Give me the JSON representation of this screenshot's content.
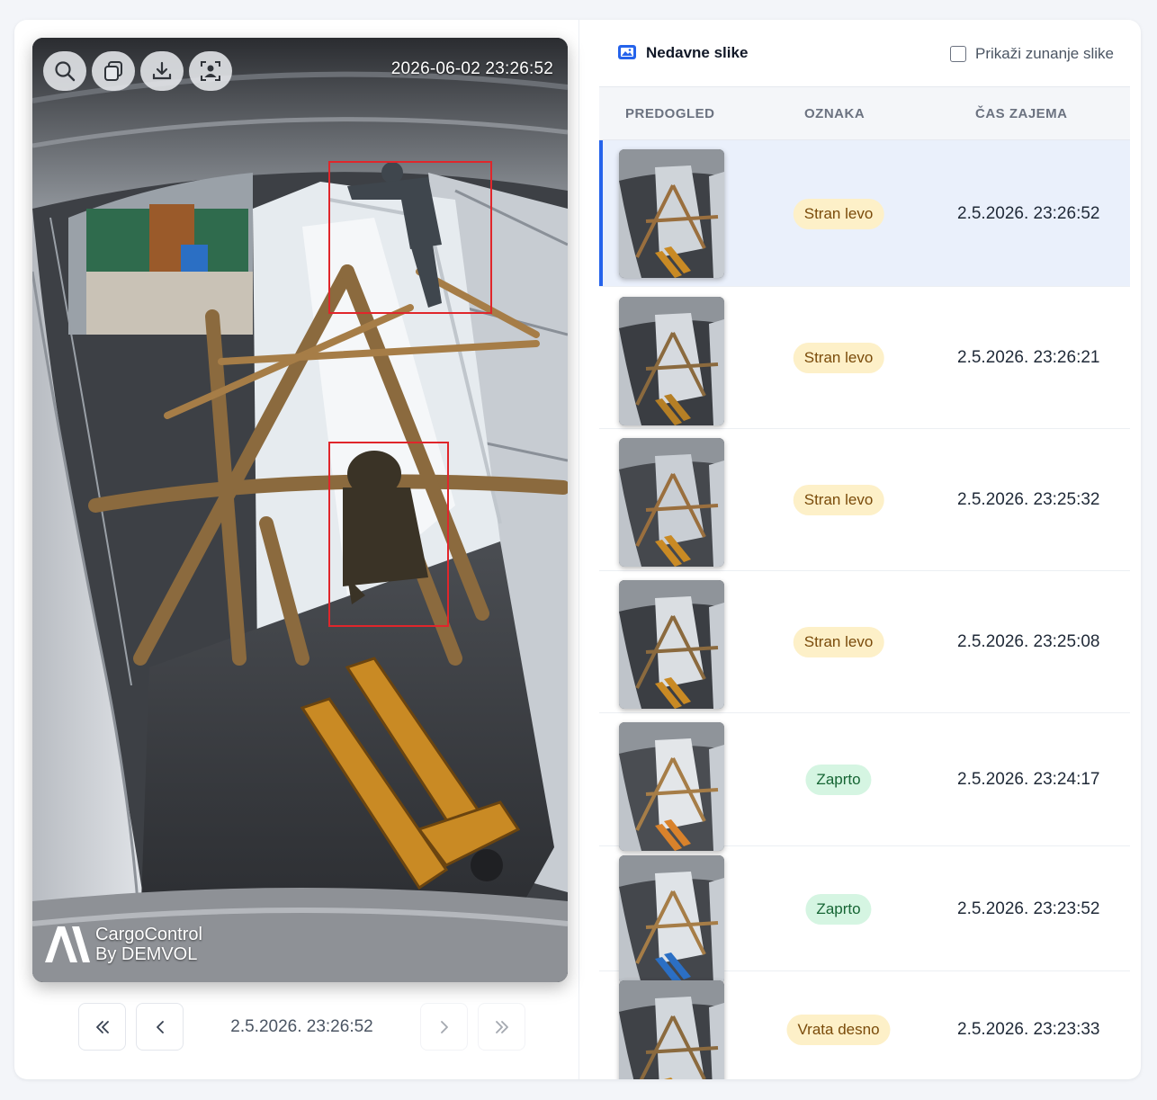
{
  "viewer": {
    "timestamp": "2026-06-02 23:26:52",
    "brand_name": "CargoControl",
    "brand_sub": "By DEMVOL",
    "tools": [
      "zoom-icon",
      "copy-icon",
      "download-icon",
      "person-detect-icon"
    ]
  },
  "pager": {
    "date": "2.5.2026. 23:26:52",
    "first_icon": "double-chevron-left-icon",
    "prev_icon": "chevron-left-icon",
    "next_icon": "chevron-right-icon",
    "last_icon": "double-chevron-right-icon"
  },
  "recent": {
    "title": "Nedavne slike",
    "title_icon": "images-icon",
    "toggle_label": "Prikaži zunanje slike",
    "toggle_checked": false,
    "columns": [
      "PREDOGLED",
      "OZNAKA",
      "ČAS ZAJEMA"
    ],
    "rows": [
      {
        "label": "Stran levo",
        "time": "2.5.2026. 23:26:52",
        "tone": "amber",
        "selected": true
      },
      {
        "label": "Stran levo",
        "time": "2.5.2026. 23:26:21",
        "tone": "amber",
        "selected": false
      },
      {
        "label": "Stran levo",
        "time": "2.5.2026. 23:25:32",
        "tone": "amber",
        "selected": false
      },
      {
        "label": "Stran levo",
        "time": "2.5.2026. 23:25:08",
        "tone": "amber",
        "selected": false
      },
      {
        "label": "Zaprto",
        "time": "2.5.2026. 23:24:17",
        "tone": "green",
        "selected": false
      },
      {
        "label": "Zaprto",
        "time": "2.5.2026. 23:23:52",
        "tone": "green",
        "selected": false
      },
      {
        "label": "Vrata desno",
        "time": "2.5.2026. 23:23:33",
        "tone": "amber",
        "selected": false
      }
    ]
  },
  "colors": {
    "accent": "#2563eb",
    "badge_amber_bg": "#fdf0c8",
    "badge_green_bg": "#d5f5e2",
    "detection_box": "#e0262b"
  }
}
